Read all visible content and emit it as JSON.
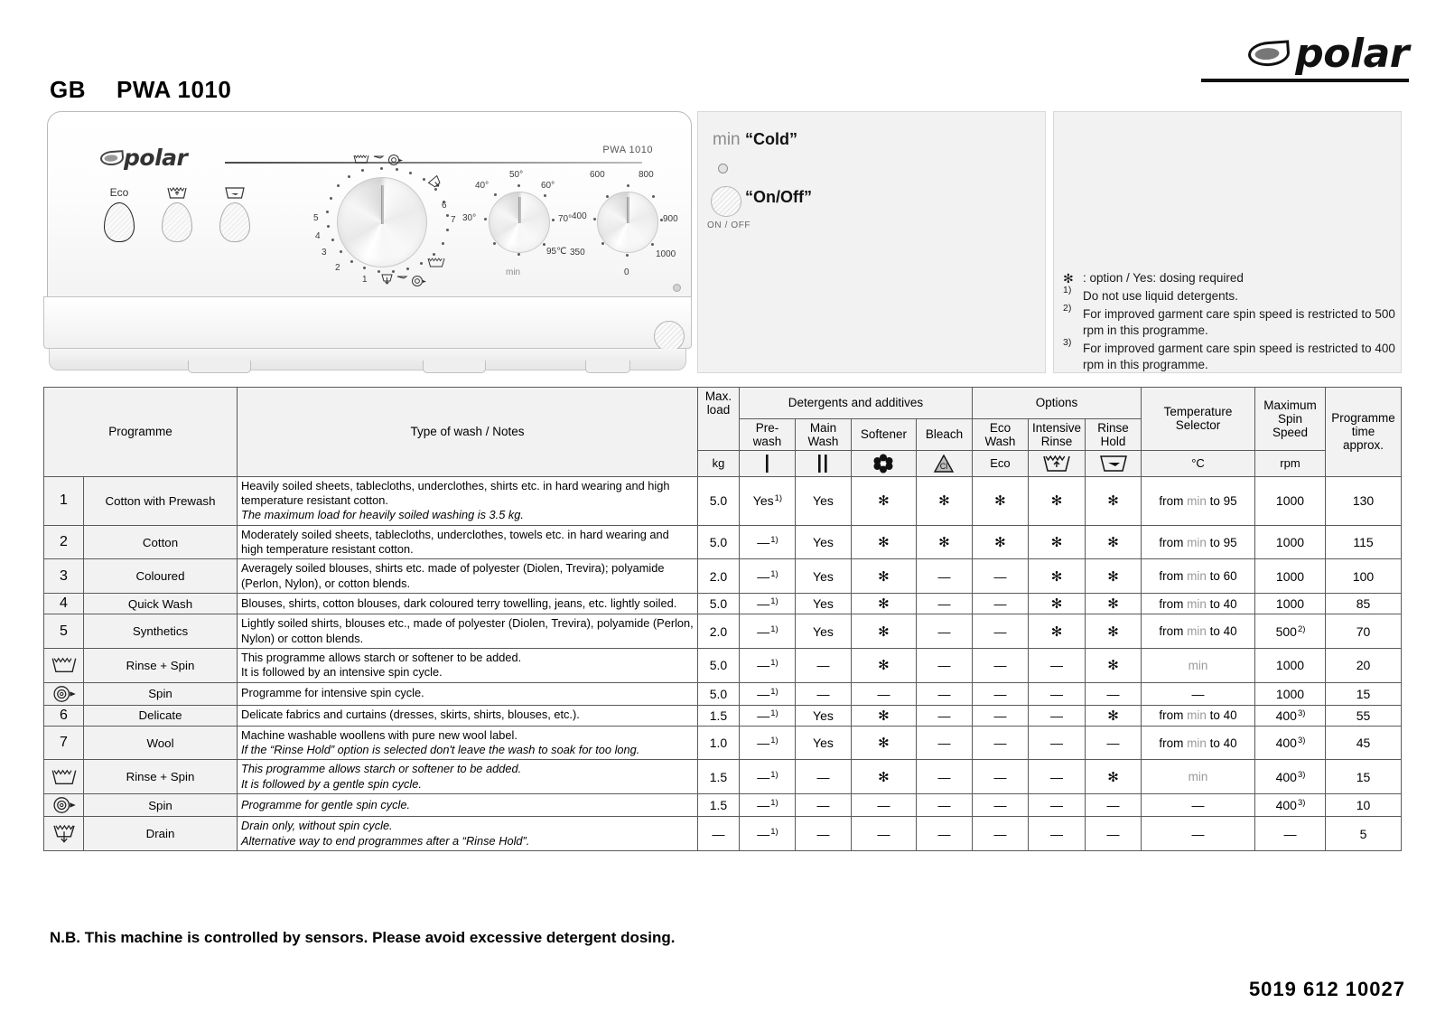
{
  "header": {
    "country_code": "GB",
    "model": "PWA 1010",
    "brand": "polar"
  },
  "machine": {
    "panel_brand": "polar",
    "panel_model": "PWA 1010",
    "buttons": [
      {
        "label": "Eco",
        "icon": "eco-text",
        "selected": true
      },
      {
        "label": "",
        "icon": "intensive-rinse-icon",
        "selected": false
      },
      {
        "label": "",
        "icon": "rinse-hold-icon",
        "selected": false
      }
    ],
    "programme_dial": {
      "name": "programme-selector",
      "labels": [
        "1",
        "2",
        "3",
        "4",
        "5",
        "6",
        "7"
      ],
      "symbol_labels": [
        "rinse-spin",
        "spin",
        "drain"
      ]
    },
    "temperature_dial": {
      "name": "temperature-selector",
      "labels": [
        "min",
        "30°",
        "40°",
        "50°",
        "60°",
        "70°",
        "95℃"
      ]
    },
    "spin_dial": {
      "name": "spin-speed-selector",
      "labels": [
        "0",
        "350",
        "400",
        "600",
        "800",
        "900",
        "1000"
      ]
    },
    "onoff_caption": "ON / OFF"
  },
  "legend": {
    "min_label": "min",
    "cold_label": "“Cold”",
    "onoff_label": "“On/Off”",
    "onoff_caption": "ON / OFF",
    "notes": [
      {
        "mark": "✻",
        "text": ": option / Yes: dosing required"
      },
      {
        "mark": "1)",
        "text": "Do not use liquid detergents."
      },
      {
        "mark": "2)",
        "text": "For improved garment care spin speed is restricted to 500 rpm in this programme."
      },
      {
        "mark": "3)",
        "text": "For improved garment care spin speed is restricted to 400 rpm in this programme."
      }
    ]
  },
  "table": {
    "headers": {
      "programme": "Programme",
      "type_of_wash": "Type of wash / Notes",
      "max_load": "Max.\nload",
      "max_load_unit": "kg",
      "detergents_group": "Detergents and additives",
      "options_group": "Options",
      "prewash": "Pre-\nwash",
      "main_wash": "Main\nWash",
      "softener": "Softener",
      "bleach": "Bleach",
      "eco_wash": "Eco\nWash",
      "eco_wash_symbol": "Eco",
      "intensive_rinse": "Intensive\nRinse",
      "rinse_hold": "Rinse\nHold",
      "temperature_selector": "Temperature\nSelector",
      "temperature_unit": "°C",
      "max_spin_speed": "Maximum\nSpin Speed",
      "spin_unit": "rpm",
      "programme_time": "Programme\ntime\napprox."
    },
    "rows": [
      {
        "num": "1",
        "icon": "",
        "programme": "Cotton with Prewash",
        "desc": "Heavily soiled sheets, tablecloths, underclothes, shirts etc. in hard wearing and high temperature resistant cotton.",
        "desc_italic": "The maximum load for heavily soiled washing is 3.5 kg.",
        "load": "5.0",
        "prewash": "Yes",
        "prewash_sup": "1)",
        "main_wash": "Yes",
        "softener": "✻",
        "bleach": "✻",
        "eco_wash": "✻",
        "intensive_rinse": "✻",
        "rinse_hold": "✻",
        "temp_prefix": "from",
        "temp_min": "min",
        "temp_mid": "to",
        "temp_max": "95",
        "spin": "1000",
        "spin_sup": "",
        "time": "130"
      },
      {
        "num": "2",
        "icon": "",
        "programme": "Cotton",
        "desc": "Moderately soiled sheets, tablecloths, underclothes, towels etc. in hard wearing and high temperature resistant cotton.",
        "desc_italic": "",
        "load": "5.0",
        "prewash": "—",
        "prewash_sup": "1)",
        "main_wash": "Yes",
        "softener": "✻",
        "bleach": "✻",
        "eco_wash": "✻",
        "intensive_rinse": "✻",
        "rinse_hold": "✻",
        "temp_prefix": "from",
        "temp_min": "min",
        "temp_mid": "to",
        "temp_max": "95",
        "spin": "1000",
        "spin_sup": "",
        "time": "115"
      },
      {
        "num": "3",
        "icon": "",
        "programme": "Coloured",
        "desc": "Averagely soiled blouses, shirts etc. made of polyester (Diolen, Trevira); polyamide (Perlon, Nylon), or cotton blends.",
        "desc_italic": "",
        "load": "2.0",
        "prewash": "—",
        "prewash_sup": "1)",
        "main_wash": "Yes",
        "softener": "✻",
        "bleach": "—",
        "eco_wash": "—",
        "intensive_rinse": "✻",
        "rinse_hold": "✻",
        "temp_prefix": "from",
        "temp_min": "min",
        "temp_mid": "to",
        "temp_max": "60",
        "spin": "1000",
        "spin_sup": "",
        "time": "100"
      },
      {
        "num": "4",
        "icon": "",
        "programme": "Quick Wash",
        "desc": "Blouses, shirts, cotton blouses, dark coloured terry towelling, jeans, etc. lightly soiled.",
        "desc_italic": "",
        "load": "5.0",
        "prewash": "—",
        "prewash_sup": "1)",
        "main_wash": "Yes",
        "softener": "✻",
        "bleach": "—",
        "eco_wash": "—",
        "intensive_rinse": "✻",
        "rinse_hold": "✻",
        "temp_prefix": "from",
        "temp_min": "min",
        "temp_mid": "to",
        "temp_max": "40",
        "spin": "1000",
        "spin_sup": "",
        "time": "85"
      },
      {
        "num": "5",
        "icon": "",
        "programme": "Synthetics",
        "desc": "Lightly soiled shirts, blouses etc., made of polyester (Diolen, Trevira), polyamide (Perlon, Nylon) or cotton blends.",
        "desc_italic": "",
        "load": "2.0",
        "prewash": "—",
        "prewash_sup": "1)",
        "main_wash": "Yes",
        "softener": "✻",
        "bleach": "—",
        "eco_wash": "—",
        "intensive_rinse": "✻",
        "rinse_hold": "✻",
        "temp_prefix": "from",
        "temp_min": "min",
        "temp_mid": "to",
        "temp_max": "40",
        "spin": "500",
        "spin_sup": "2)",
        "time": "70"
      },
      {
        "num": "",
        "icon": "rinse-spin-icon",
        "programme": "Rinse + Spin",
        "desc": "This programme allows starch or softener to be added.\nIt is followed by an intensive spin cycle.",
        "desc_italic": "",
        "load": "5.0",
        "prewash": "—",
        "prewash_sup": "1)",
        "main_wash": "—",
        "softener": "✻",
        "bleach": "—",
        "eco_wash": "—",
        "intensive_rinse": "—",
        "rinse_hold": "✻",
        "temp_prefix": "",
        "temp_min": "min",
        "temp_mid": "",
        "temp_max": "",
        "spin": "1000",
        "spin_sup": "",
        "time": "20"
      },
      {
        "num": "",
        "icon": "spin-icon",
        "programme": "Spin",
        "desc": "Programme for intensive spin cycle.",
        "desc_italic": "",
        "load": "5.0",
        "prewash": "—",
        "prewash_sup": "1)",
        "main_wash": "—",
        "softener": "—",
        "bleach": "—",
        "eco_wash": "—",
        "intensive_rinse": "—",
        "rinse_hold": "—",
        "temp_prefix": "",
        "temp_min": "",
        "temp_mid": "",
        "temp_max": "—",
        "spin": "1000",
        "spin_sup": "",
        "time": "15"
      },
      {
        "num": "6",
        "icon": "",
        "programme": "Delicate",
        "desc": "Delicate fabrics and curtains (dresses, skirts, shirts, blouses, etc.).",
        "desc_italic": "",
        "load": "1.5",
        "prewash": "—",
        "prewash_sup": "1)",
        "main_wash": "Yes",
        "softener": "✻",
        "bleach": "—",
        "eco_wash": "—",
        "intensive_rinse": "—",
        "rinse_hold": "✻",
        "temp_prefix": "from",
        "temp_min": "min",
        "temp_mid": "to",
        "temp_max": "40",
        "spin": "400",
        "spin_sup": "3)",
        "time": "55"
      },
      {
        "num": "7",
        "icon": "",
        "programme": "Wool",
        "desc": "Machine washable woollens with pure new wool label.",
        "desc_italic": "If the “Rinse Hold” option is selected don't leave the wash to soak for too long.",
        "load": "1.0",
        "prewash": "—",
        "prewash_sup": "1)",
        "main_wash": "Yes",
        "softener": "✻",
        "bleach": "—",
        "eco_wash": "—",
        "intensive_rinse": "—",
        "rinse_hold": "—",
        "temp_prefix": "from",
        "temp_min": "min",
        "temp_mid": "to",
        "temp_max": "40",
        "spin": "400",
        "spin_sup": "3)",
        "time": "45"
      },
      {
        "num": "",
        "icon": "rinse-spin-icon",
        "programme": "Rinse + Spin",
        "desc": "",
        "desc_italic": "This programme allows starch or softener to be added.\nIt is followed by a gentle spin cycle.",
        "load": "1.5",
        "prewash": "—",
        "prewash_sup": "1)",
        "main_wash": "—",
        "softener": "✻",
        "bleach": "—",
        "eco_wash": "—",
        "intensive_rinse": "—",
        "rinse_hold": "✻",
        "temp_prefix": "",
        "temp_min": "min",
        "temp_mid": "",
        "temp_max": "",
        "spin": "400",
        "spin_sup": "3)",
        "time": "15"
      },
      {
        "num": "",
        "icon": "spin-icon",
        "programme": "Spin",
        "desc": "",
        "desc_italic": "Programme for gentle spin cycle.",
        "load": "1.5",
        "prewash": "—",
        "prewash_sup": "1)",
        "main_wash": "—",
        "softener": "—",
        "bleach": "—",
        "eco_wash": "—",
        "intensive_rinse": "—",
        "rinse_hold": "—",
        "temp_prefix": "",
        "temp_min": "",
        "temp_mid": "",
        "temp_max": "—",
        "spin": "400",
        "spin_sup": "3)",
        "time": "10"
      },
      {
        "num": "",
        "icon": "drain-icon",
        "programme": "Drain",
        "desc": "",
        "desc_italic": "Drain only, without spin cycle.\nAlternative way to end programmes after a “Rinse Hold”.",
        "load": "—",
        "prewash": "—",
        "prewash_sup": "1)",
        "main_wash": "—",
        "softener": "—",
        "bleach": "—",
        "eco_wash": "—",
        "intensive_rinse": "—",
        "rinse_hold": "—",
        "temp_prefix": "",
        "temp_min": "",
        "temp_mid": "",
        "temp_max": "—",
        "spin": "—",
        "spin_sup": "",
        "time": "5"
      }
    ]
  },
  "footer": {
    "note": "N.B. This machine is controlled by sensors. Please avoid excessive detergent dosing.",
    "doc_number": "5019 612 10027"
  }
}
